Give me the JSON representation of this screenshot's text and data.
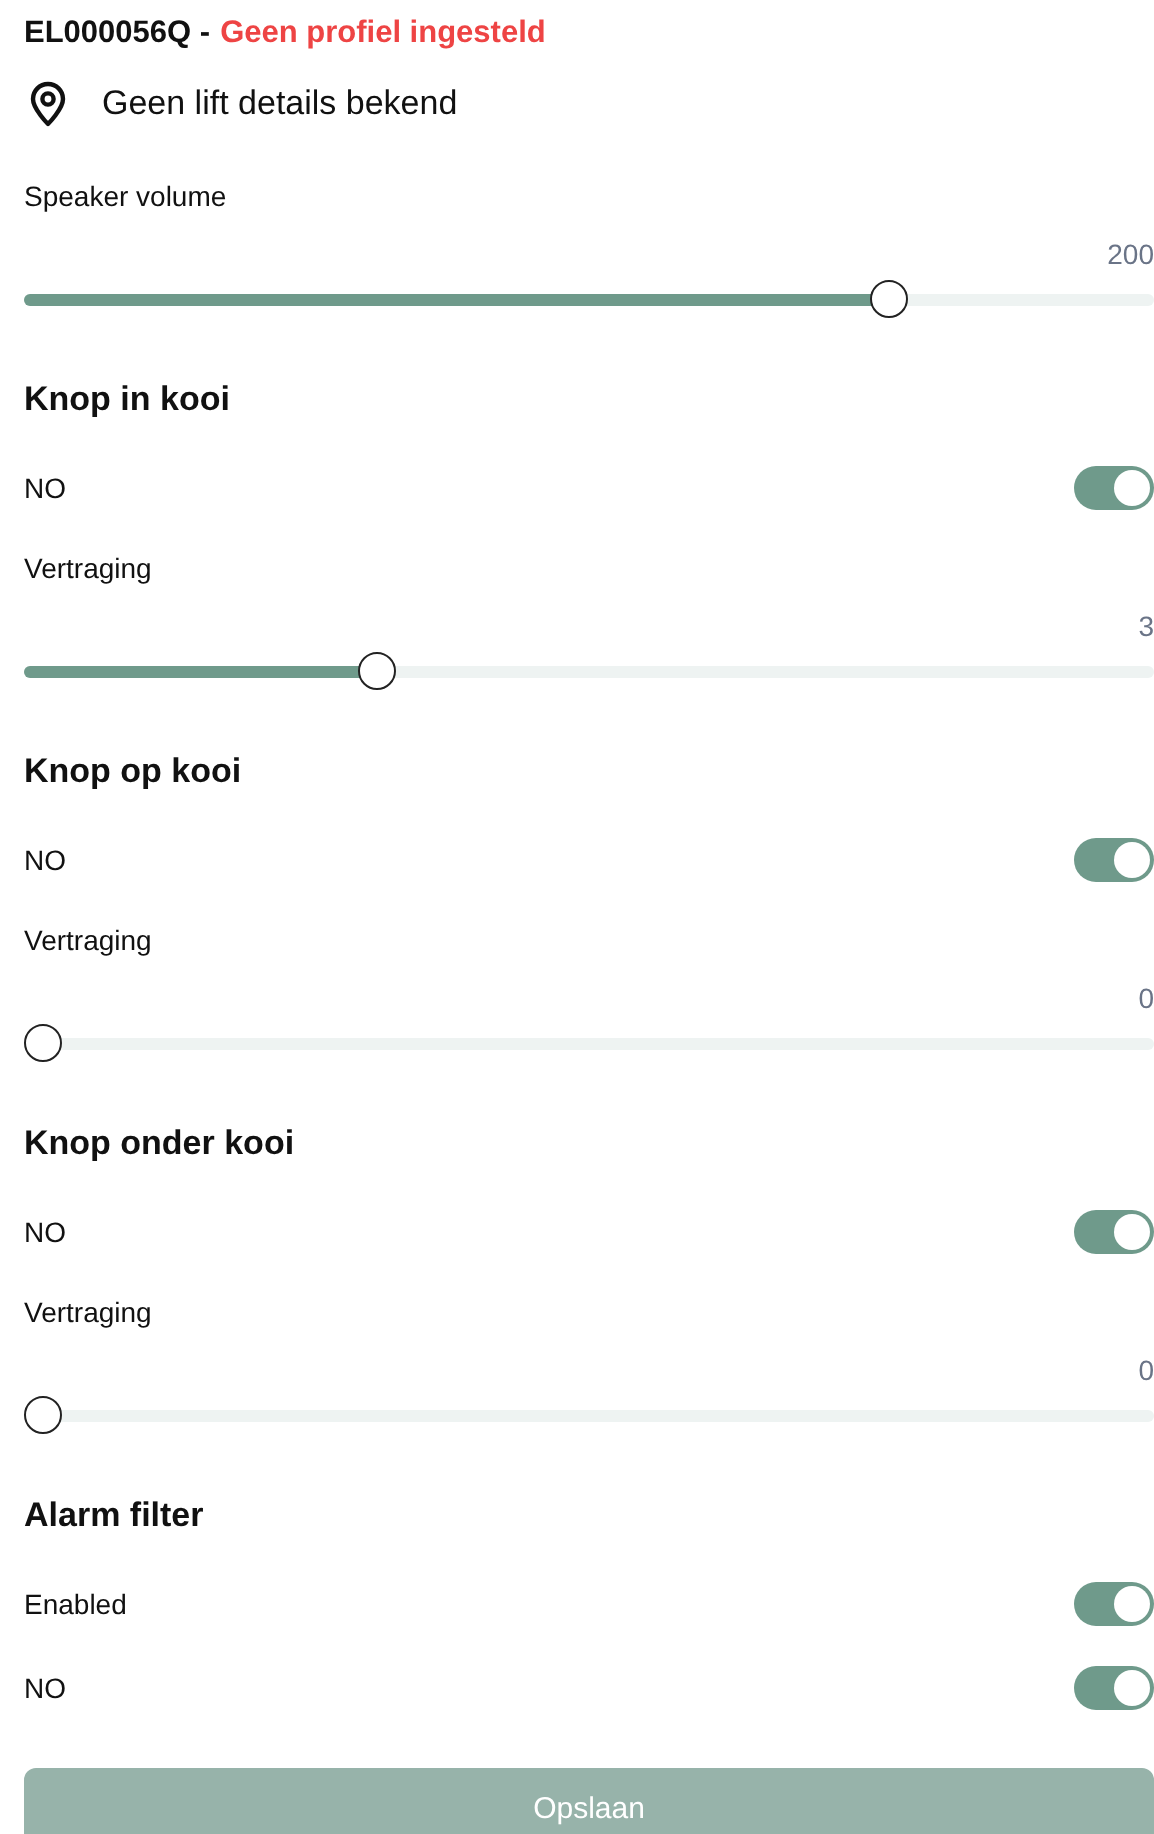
{
  "header": {
    "device_id": "EL000056Q -",
    "status": "Geen profiel ingesteld"
  },
  "location": "Geen lift details bekend",
  "controls": [
    {
      "kind": "slider",
      "label": "Speaker volume",
      "value": "200",
      "level": 0.777
    },
    {
      "kind": "heading",
      "title": "Knop in kooi"
    },
    {
      "kind": "toggle",
      "label": "NO",
      "on": true
    },
    {
      "kind": "slider",
      "label": "Vertraging",
      "value": "3",
      "level": 0.306
    },
    {
      "kind": "heading",
      "title": "Knop op kooi"
    },
    {
      "kind": "toggle",
      "label": "NO",
      "on": true
    },
    {
      "kind": "slider",
      "label": "Vertraging",
      "value": "0",
      "level": 0
    },
    {
      "kind": "heading",
      "title": "Knop onder kooi"
    },
    {
      "kind": "toggle",
      "label": "NO",
      "on": true
    },
    {
      "kind": "slider",
      "label": "Vertraging",
      "value": "0",
      "level": 0
    },
    {
      "kind": "heading",
      "title": "Alarm filter"
    },
    {
      "kind": "toggle",
      "label": "Enabled",
      "on": true
    },
    {
      "kind": "toggle",
      "label": "NO",
      "on": true
    }
  ],
  "save_button": {
    "label": "Opslaan",
    "disabled": true
  }
}
